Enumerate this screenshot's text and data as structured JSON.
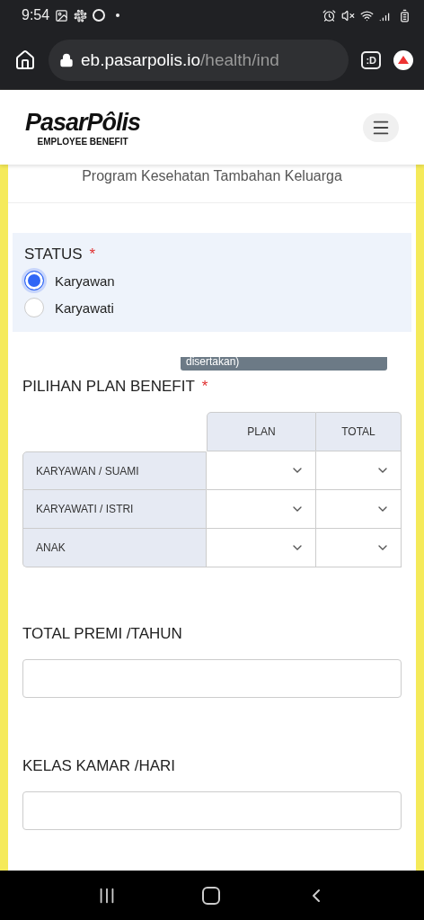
{
  "status_bar": {
    "time": "9:54"
  },
  "browser": {
    "url_host": "eb.pasarpolis.io",
    "url_path": "/health/ind",
    "tab_badge": ":D"
  },
  "header": {
    "logo": "PasarPôlis",
    "logo_subtitle": "EMPLOYEE BENEFIT"
  },
  "subtitle": "Program Kesehatan Tambahan Keluarga",
  "status": {
    "label": "STATUS",
    "required_mark": "*",
    "options": [
      {
        "label": "Karyawan",
        "selected": true
      },
      {
        "label": "Karyawati",
        "selected": false
      }
    ]
  },
  "tooltip": "disertakan)",
  "plan_benefit": {
    "label": "PILIHAN PLAN BENEFIT",
    "required_mark": "*",
    "columns": [
      "PLAN",
      "TOTAL"
    ],
    "rows": [
      {
        "label": "KARYAWAN / SUAMI"
      },
      {
        "label": "KARYAWATI / ISTRI"
      },
      {
        "label": "ANAK"
      }
    ]
  },
  "fields": [
    {
      "label": "TOTAL PREMI /TAHUN"
    },
    {
      "label": "KELAS KAMAR /HARI"
    }
  ]
}
